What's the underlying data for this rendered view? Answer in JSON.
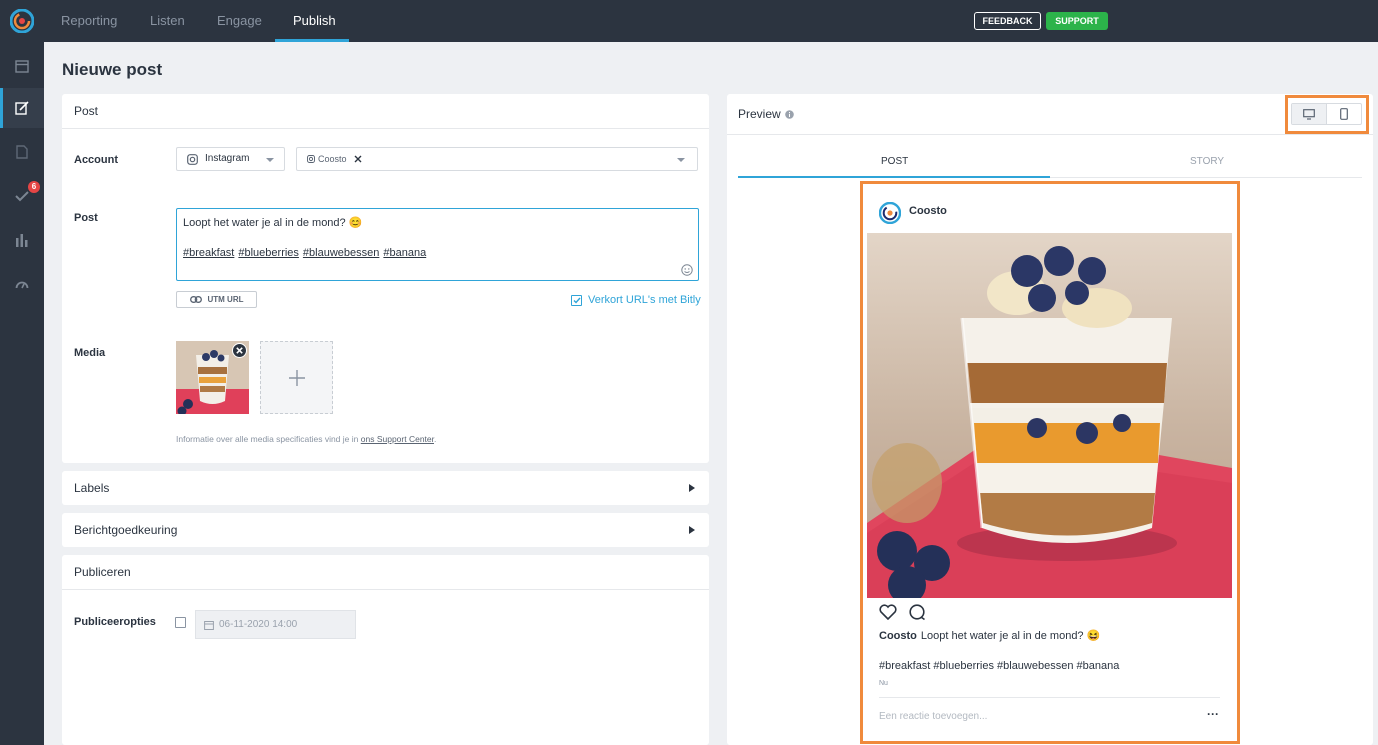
{
  "topnav": {
    "tabs": [
      {
        "label": "Reporting"
      },
      {
        "label": "Listen"
      },
      {
        "label": "Engage"
      },
      {
        "label": "Publish"
      }
    ],
    "feedback_label": "FEEDBACK",
    "support_label": "SUPPORT"
  },
  "sidebar": {
    "items": [
      {
        "icon": "calendar-icon"
      },
      {
        "icon": "compose-icon"
      },
      {
        "icon": "document-icon"
      },
      {
        "icon": "checkmark-icon",
        "badge": "6"
      },
      {
        "icon": "bar-chart-icon"
      },
      {
        "icon": "gauge-icon"
      }
    ]
  },
  "page": {
    "title": "Nieuwe post"
  },
  "post_card": {
    "title": "Post",
    "account_label": "Account",
    "network_value": "Instagram",
    "account_chip": "Coosto",
    "post_label": "Post",
    "post_text_line1": "Loopt het water je al in de mond? 😊",
    "hashtags": [
      "#breakfast",
      "#blueberries",
      "#blauwebessen",
      "#banana"
    ],
    "utm_label": "UTM URL",
    "bitly_label": "Verkort URL's met Bitly",
    "media_label": "Media",
    "media_info_prefix": "Informatie over alle media specificaties vind je in",
    "media_info_link": "ons Support Center",
    "media_info_suffix": "."
  },
  "labels_card": {
    "title": "Labels"
  },
  "approval_card": {
    "title": "Berichtgoedkeuring"
  },
  "publish_card": {
    "title": "Publiceren",
    "options_label": "Publiceeropties",
    "date_value": "06-11-2020 14:00"
  },
  "preview": {
    "title": "Preview",
    "tabs": [
      {
        "label": "POST"
      },
      {
        "label": "STORY"
      }
    ],
    "ig_username": "Coosto",
    "caption_user": "Coosto",
    "caption_text": "Loopt het water je al in de mond? 😆",
    "hashtags_text": "#breakfast #blueberries #blauwebessen #banana",
    "time": "Nu",
    "comment_placeholder": "Een reactie toevoegen...",
    "more": "···"
  },
  "colors": {
    "accent": "#2fa4d8",
    "highlight": "#f08a3c",
    "support_green": "#2cb34a",
    "dark_bg": "#2c3440"
  }
}
